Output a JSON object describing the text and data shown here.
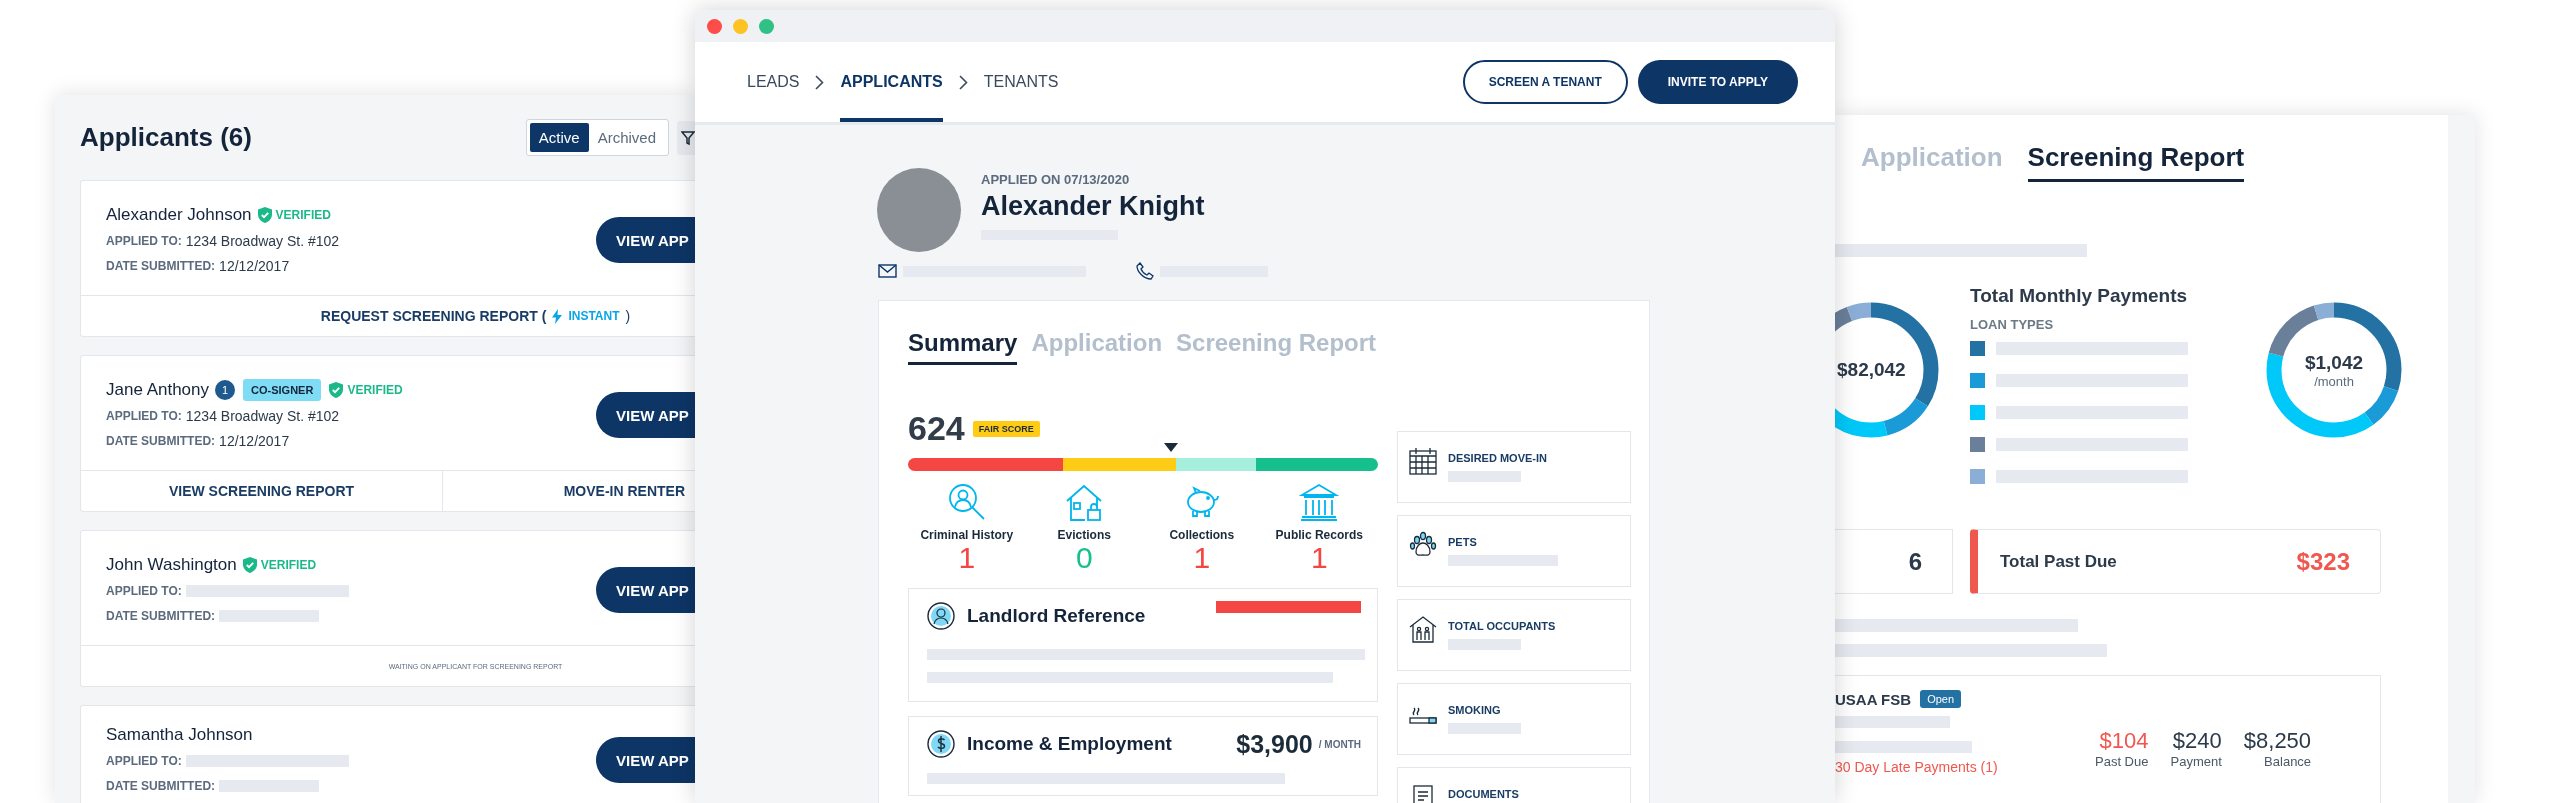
{
  "applicants_window": {
    "title": "Applicants (6)",
    "filters": [
      {
        "label": "Active",
        "selected": true
      },
      {
        "label": "Archived",
        "selected": false
      }
    ],
    "applicants": [
      {
        "name": "Alexander Johnson",
        "verified": "VERIFIED",
        "applied_label": "APPLIED TO:",
        "applied_to": "1234 Broadway St. #102",
        "date_label": "DATE SUBMITTED:",
        "date": "12/12/2017",
        "button": "VIEW APP",
        "footer": {
          "kind": "request",
          "label": "REQUEST SCREENING REPORT (",
          "tag": "INSTANT",
          "end": ")"
        }
      },
      {
        "name": "Jane Anthony",
        "count": "1",
        "role": "CO-SIGNER",
        "verified": "VERIFIED",
        "applied_label": "APPLIED TO:",
        "applied_to": "1234 Broadway St. #102",
        "date_label": "DATE SUBMITTED:",
        "date": "12/12/2017",
        "button": "VIEW APP",
        "footer": {
          "kind": "split",
          "actions": [
            "VIEW SCREENING REPORT",
            "MOVE-IN RENTER"
          ]
        }
      },
      {
        "name": "John Washington",
        "verified": "VERIFIED",
        "applied_label": "APPLIED TO:",
        "date_label": "DATE SUBMITTED:",
        "button": "VIEW APP",
        "footer": {
          "kind": "note",
          "text": "WAITING ON APPLICANT FOR SCREENING REPORT"
        }
      },
      {
        "name": "Samantha Johnson",
        "applied_label": "APPLIED TO:",
        "date_label": "DATE SUBMITTED:",
        "button": "VIEW APP"
      }
    ]
  },
  "applicant_window": {
    "breadcrumbs": [
      {
        "label": "LEADS",
        "selected": false
      },
      {
        "label": "APPLICANTS",
        "selected": true
      },
      {
        "label": "TENANTS",
        "selected": false
      }
    ],
    "buttons": [
      {
        "label": "SCREEN A TENANT",
        "kind": "outline"
      },
      {
        "label": "INVITE TO APPLY",
        "kind": "primary"
      }
    ],
    "applied_on": "APPLIED ON 07/13/2020",
    "name": "Alexander Knight",
    "tabs": [
      {
        "label": "Summary",
        "selected": true
      },
      {
        "label": "Application",
        "selected": false
      },
      {
        "label": "Screening Report",
        "selected": false
      }
    ],
    "score": {
      "value": "624",
      "rating": "FAIR SCORE",
      "level": 0.56
    },
    "records": [
      {
        "label": "Criminal History",
        "count": "1",
        "kind": "alert"
      },
      {
        "label": "Evictions",
        "count": "0",
        "kind": "ok"
      },
      {
        "label": "Collections",
        "count": "1",
        "kind": "alert"
      },
      {
        "label": "Public Records",
        "count": "1",
        "kind": "alert"
      }
    ],
    "landlord": {
      "title": "Landlord Reference"
    },
    "income": {
      "title": "Income & Employment",
      "amount": "$3,900",
      "unit": "/ MONTH"
    },
    "details": [
      {
        "title": "DESIRED MOVE-IN"
      },
      {
        "title": "PETS"
      },
      {
        "title": "TOTAL OCCUPANTS"
      },
      {
        "title": "SMOKING"
      },
      {
        "title": "DOCUMENTS"
      }
    ]
  },
  "report_window": {
    "tabs": [
      {
        "label": "Application",
        "selected": false
      },
      {
        "label": "Screening Report",
        "selected": true
      }
    ],
    "total_debt": "$82,042",
    "monthly": {
      "title": "Total Monthly Payments",
      "legend_title": "LOAN TYPES",
      "amount": "$1,042",
      "unit": "/month"
    },
    "loan_types": [
      {
        "color": "#2471a3"
      },
      {
        "color": "#1a9bd7"
      },
      {
        "color": "#00c8f8"
      },
      {
        "color": "#6a7f99"
      },
      {
        "color": "#8aaed6"
      }
    ],
    "accounts_count": "6",
    "past_due": {
      "label": "Total Past Due",
      "amount": "$323"
    },
    "account": {
      "name": "USAA FSB",
      "status": "Open",
      "figures": [
        {
          "value": "$104",
          "label": "Past Due",
          "alert": true
        },
        {
          "value": "$240",
          "label": "Payment",
          "alert": false
        },
        {
          "value": "$8,250",
          "label": "Balance",
          "alert": false
        }
      ],
      "late": "30 Day Late Payments (1)"
    }
  }
}
